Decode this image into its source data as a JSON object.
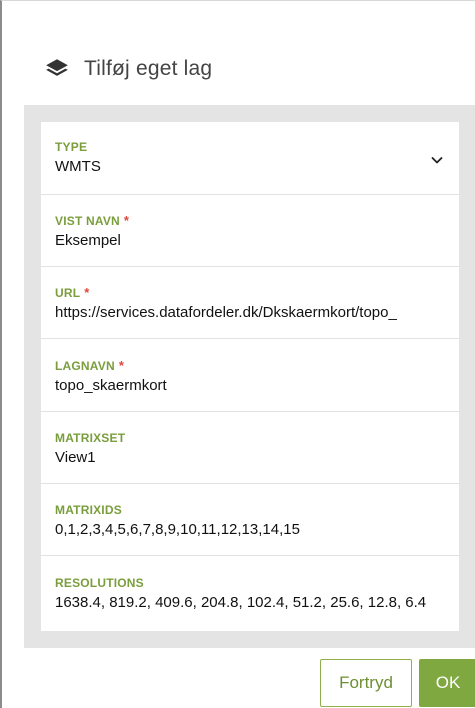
{
  "dialog": {
    "title": "Tilføj eget lag",
    "icon": "layers-icon"
  },
  "fields": [
    {
      "label": "TYPE",
      "required": false,
      "value": "WMTS",
      "control": "select",
      "icon": "chevron-down-icon"
    },
    {
      "label": "VIST NAVN",
      "required": true,
      "value": "Eksempel"
    },
    {
      "label": "URL",
      "required": true,
      "value": "https://services.datafordeler.dk/Dkskaermkort/topo_"
    },
    {
      "label": "LAGNAVN",
      "required": true,
      "value": "topo_skaermkort"
    },
    {
      "label": "MATRIXSET",
      "required": false,
      "value": "View1"
    },
    {
      "label": "MATRIXIDS",
      "required": false,
      "value": "0,1,2,3,4,5,6,7,8,9,10,11,12,13,14,15"
    },
    {
      "label": "RESOLUTIONS",
      "required": false,
      "value": "1638.4, 819.2, 409.6, 204.8, 102.4, 51.2, 25.6, 12.8, 6.4"
    }
  ],
  "required_marker": "*",
  "buttons": {
    "cancel_label": "Fortryd",
    "ok_label": "OK"
  },
  "colors": {
    "label": "#7a9e3c",
    "required": "#e0463e",
    "primary": "#7fa840",
    "panel_bg": "#e4e4e4"
  }
}
